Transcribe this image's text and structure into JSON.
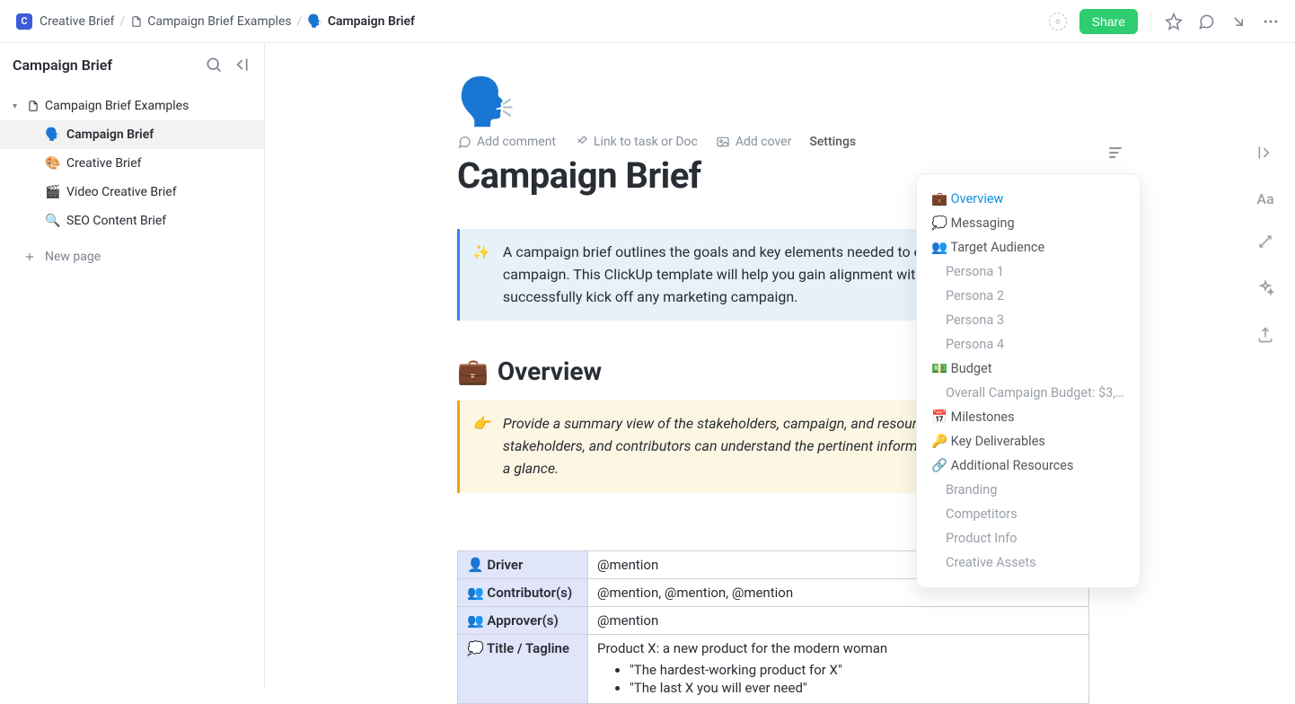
{
  "breadcrumb": {
    "workspace_initial": "C",
    "root": "Creative Brief",
    "mid": "Campaign Brief Examples",
    "current_emoji": "🗣️",
    "current": "Campaign Brief"
  },
  "topbar": {
    "share": "Share"
  },
  "sidebar": {
    "title": "Campaign Brief",
    "root_label": "Campaign Brief Examples",
    "items": [
      {
        "emoji": "🗣️",
        "label": "Campaign Brief",
        "active": true
      },
      {
        "emoji": "🎨",
        "label": "Creative Brief",
        "active": false
      },
      {
        "emoji": "🎬",
        "label": "Video Creative Brief",
        "active": false
      },
      {
        "emoji": "🔍",
        "label": "SEO Content Brief",
        "active": false
      }
    ],
    "new_page": "New page"
  },
  "doc": {
    "emoji_large": "🗣️",
    "actions": {
      "comment": "Add comment",
      "link": "Link to task or Doc",
      "cover": "Add cover",
      "settings": "Settings"
    },
    "title": "Campaign Brief",
    "callout_intro_icon": "✨",
    "callout_intro": "A campaign brief outlines the goals and key elements needed to execute a successful campaign. This ClickUp template will help you gain alignment with stakeholders and successfully kick off any marketing campaign.",
    "overview_heading_emoji": "💼",
    "overview_heading": "Overview",
    "callout_overview_icon": "👉",
    "callout_overview": "Provide a summary view of the stakeholders, campaign, and resources. Leadership, stakeholders, and contributors can understand the pertinent information of the campaign at a glance.",
    "table": {
      "driver_label": "👤 Driver",
      "driver_value": "@mention",
      "contributors_label": "👥 Contributor(s)",
      "contributors_value": "@mention, @mention, @mention",
      "approvers_label": "👥 Approver(s)",
      "approvers_value": "@mention",
      "title_label": "💭 Title / Tagline",
      "title_value": "Product X: a new product for the modern woman",
      "taglines": [
        "\"The hardest-working product for X\"",
        "\"The last X you will ever need\""
      ]
    }
  },
  "toc": {
    "items": [
      {
        "emoji": "💼",
        "label": "Overview",
        "active": true
      },
      {
        "emoji": "💭",
        "label": "Messaging"
      },
      {
        "emoji": "👥",
        "label": "Target Audience"
      },
      {
        "label": "Persona 1",
        "sub": true
      },
      {
        "label": "Persona 2",
        "sub": true
      },
      {
        "label": "Persona 3",
        "sub": true
      },
      {
        "label": "Persona 4",
        "sub": true
      },
      {
        "emoji": "💵",
        "label": "Budget"
      },
      {
        "label": "Overall Campaign Budget: $3,…",
        "sub": true
      },
      {
        "emoji": "📅",
        "label": "Milestones"
      },
      {
        "emoji": "🔑",
        "label": "Key Deliverables"
      },
      {
        "emoji": "🔗",
        "label": "Additional Resources"
      },
      {
        "label": "Branding",
        "sub": true
      },
      {
        "label": "Competitors",
        "sub": true
      },
      {
        "label": "Product Info",
        "sub": true
      },
      {
        "label": "Creative Assets",
        "sub": true
      }
    ]
  }
}
